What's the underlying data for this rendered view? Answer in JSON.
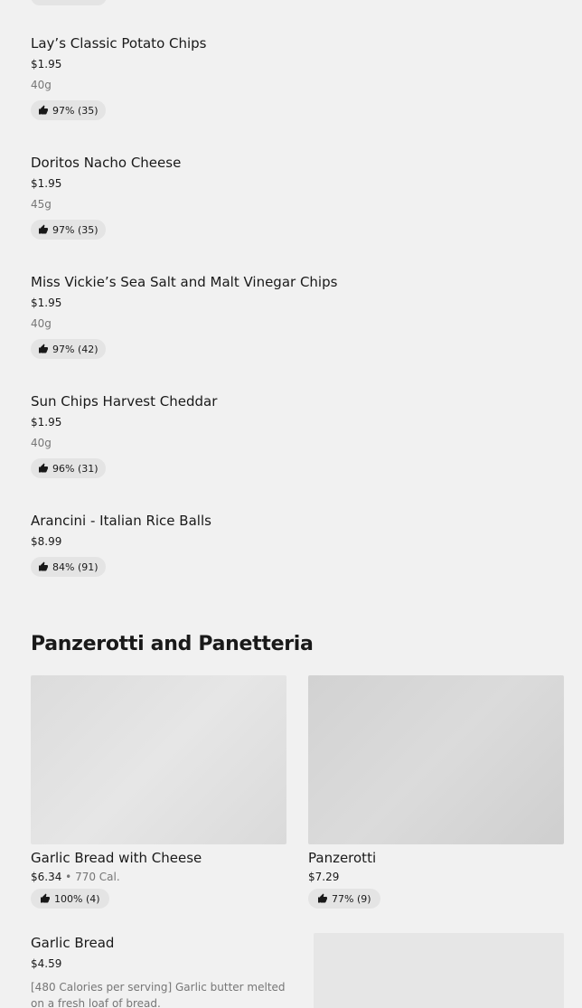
{
  "items": [
    {
      "name": "Lay’s Classic Potato Chips",
      "price": "$1.95",
      "size": "40g",
      "rating": "97% (35)"
    },
    {
      "name": "Doritos Nacho Cheese",
      "price": "$1.95",
      "size": "45g",
      "rating": "97% (35)"
    },
    {
      "name": "Miss Vickie’s Sea Salt and Malt Vinegar Chips",
      "price": "$1.95",
      "size": "40g",
      "rating": "97% (42)"
    },
    {
      "name": "Sun Chips Harvest Cheddar",
      "price": "$1.95",
      "size": "40g",
      "rating": "96% (31)"
    },
    {
      "name": "Arancini - Italian Rice Balls",
      "price": "$8.99",
      "rating": "84% (91)"
    }
  ],
  "section": {
    "title": "Panzerotti and Panetteria",
    "cards": [
      {
        "name": "Garlic Bread with Cheese",
        "price": "$6.34",
        "separator": " • ",
        "calories": "770 Cal.",
        "rating": "100% (4)"
      },
      {
        "name": "Panzerotti",
        "price": "$7.29",
        "rating": "77% (9)"
      }
    ],
    "list_item": {
      "name": "Garlic Bread",
      "price": "$4.59",
      "description": "[480 Calories per serving] Garlic butter melted on a fresh loaf of bread."
    }
  },
  "icons": {
    "rating": "thumbs-up-icon"
  },
  "colors": {
    "background": "#f1f1f1",
    "pill": "#e4e4e4",
    "text": "#191919",
    "muted": "#767676"
  }
}
